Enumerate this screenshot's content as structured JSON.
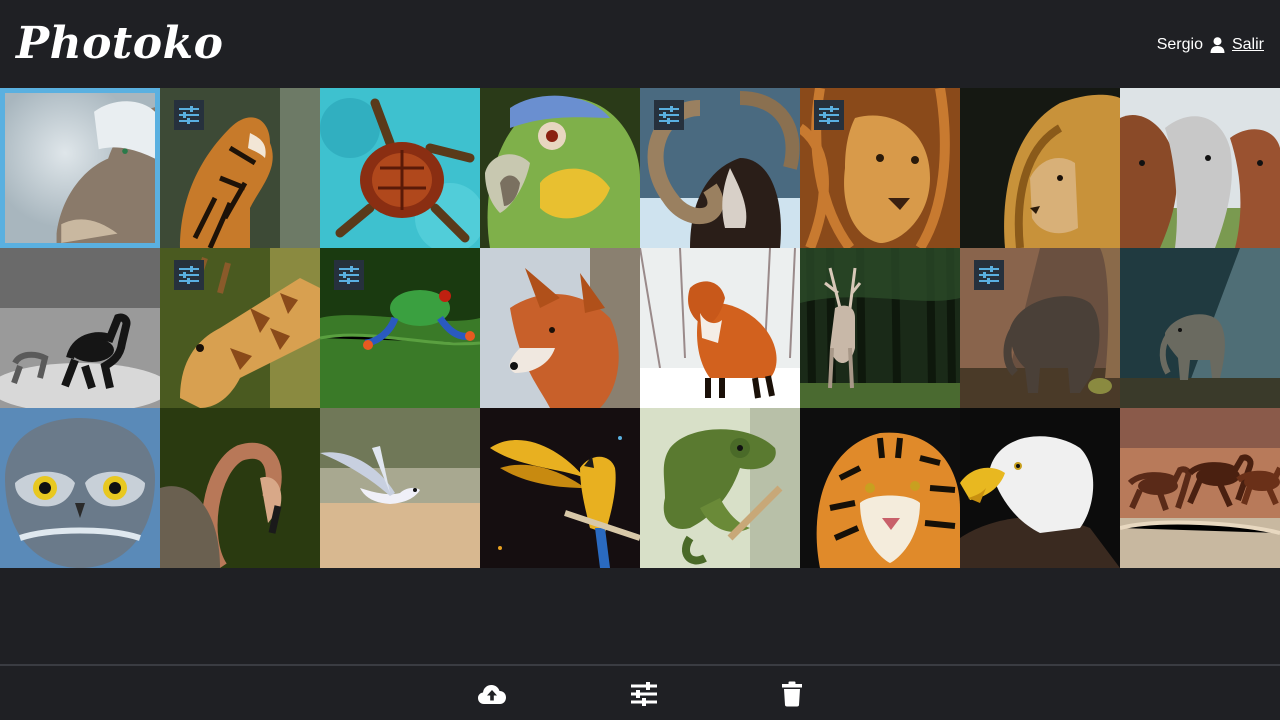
{
  "app": {
    "logo_text": "Photoko"
  },
  "user": {
    "name": "Sergio",
    "logout_label": "Salir",
    "icon": "user-icon"
  },
  "colors": {
    "background": "#1f2024",
    "selected_border": "#5ab0e0",
    "badge_bg": "#26313d",
    "badge_icon": "#5ab0e0"
  },
  "photos": [
    {
      "subject": "wolf-in-snow",
      "selected": true,
      "edited": false
    },
    {
      "subject": "tiger-roaring",
      "selected": false,
      "edited": true
    },
    {
      "subject": "sea-turtle",
      "selected": false,
      "edited": false
    },
    {
      "subject": "parrot-head",
      "selected": false,
      "edited": false
    },
    {
      "subject": "ram",
      "selected": false,
      "edited": true
    },
    {
      "subject": "lion-face",
      "selected": false,
      "edited": true
    },
    {
      "subject": "lion-profile",
      "selected": false,
      "edited": false
    },
    {
      "subject": "horses",
      "selected": false,
      "edited": false
    },
    {
      "subject": "horse-running-bw",
      "selected": false,
      "edited": false
    },
    {
      "subject": "giraffe",
      "selected": false,
      "edited": true
    },
    {
      "subject": "tree-frog",
      "selected": false,
      "edited": true
    },
    {
      "subject": "fox-portrait",
      "selected": false,
      "edited": false
    },
    {
      "subject": "fox-in-snow",
      "selected": false,
      "edited": false
    },
    {
      "subject": "deer-in-forest",
      "selected": false,
      "edited": false
    },
    {
      "subject": "baby-elephant",
      "selected": false,
      "edited": true
    },
    {
      "subject": "elephant-in-light",
      "selected": false,
      "edited": false
    },
    {
      "subject": "owl",
      "selected": false,
      "edited": false
    },
    {
      "subject": "flamingo",
      "selected": false,
      "edited": false
    },
    {
      "subject": "seagull",
      "selected": false,
      "edited": false
    },
    {
      "subject": "macaw",
      "selected": false,
      "edited": false
    },
    {
      "subject": "chameleon",
      "selected": false,
      "edited": false
    },
    {
      "subject": "tiger-face",
      "selected": false,
      "edited": false
    },
    {
      "subject": "bald-eagle",
      "selected": false,
      "edited": false
    },
    {
      "subject": "horses-galloping",
      "selected": false,
      "edited": false
    }
  ],
  "toolbar": {
    "upload_icon": "cloud-upload-icon",
    "adjust_icon": "sliders-icon",
    "delete_icon": "trash-icon"
  }
}
